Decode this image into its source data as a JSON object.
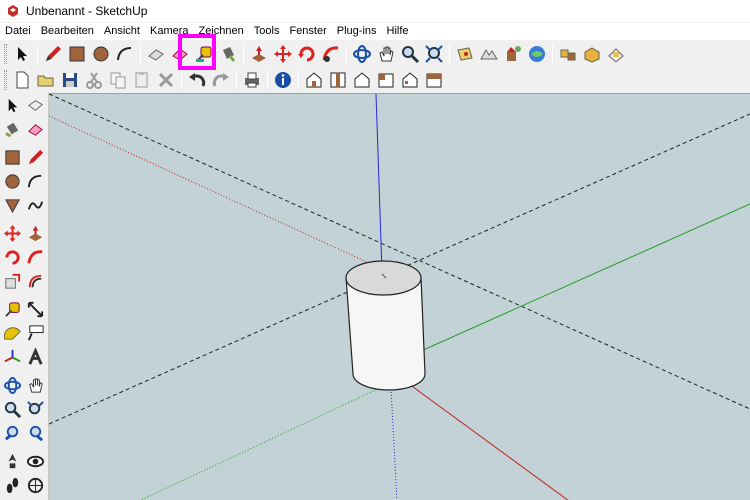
{
  "window": {
    "title": "Unbenannt - SketchUp"
  },
  "menu": [
    {
      "label": "Datei"
    },
    {
      "label": "Bearbeiten"
    },
    {
      "label": "Ansicht"
    },
    {
      "label": "Kamera"
    },
    {
      "label": "Zeichnen"
    },
    {
      "label": "Tools"
    },
    {
      "label": "Fenster"
    },
    {
      "label": "Plug-ins"
    },
    {
      "label": "Hilfe"
    }
  ],
  "toolbar_row1": [
    "select-icon",
    "line-pencil-icon",
    "rectangle-icon",
    "circle-icon",
    "arc-icon",
    "eraser-icon",
    "tape-measure-icon",
    "paint-bucket-icon",
    "push-pull-icon",
    "move-icon",
    "rotate-icon",
    "follow-me-icon",
    "orbit-icon",
    "pan-icon",
    "zoom-icon",
    "zoom-extents-icon",
    "add-location-icon",
    "toggle-terrain-icon",
    "preview-model-icon",
    "get-models-icon",
    "share-model-icon",
    "components-icon",
    "sandbox-icon"
  ],
  "toolbar_row2": [
    "new-file-icon",
    "open-file-icon",
    "save-icon",
    "cut-icon",
    "copy-icon",
    "paste-icon",
    "delete-icon",
    "undo-icon",
    "redo-icon",
    "print-icon",
    "model-info-icon",
    "iso-view-icon",
    "top-view-icon",
    "front-view-icon",
    "right-view-icon",
    "back-view-icon",
    "left-view-icon"
  ],
  "highlighted_tool": "tape-measure-icon",
  "colors": {
    "viewport_bg": "#c3d2d6",
    "axis_blue": "#2a2ad0",
    "axis_green": "#1fa01f",
    "axis_red": "#c02020",
    "highlight": "#ff00ff",
    "cylinder": "#f4f4f4"
  }
}
